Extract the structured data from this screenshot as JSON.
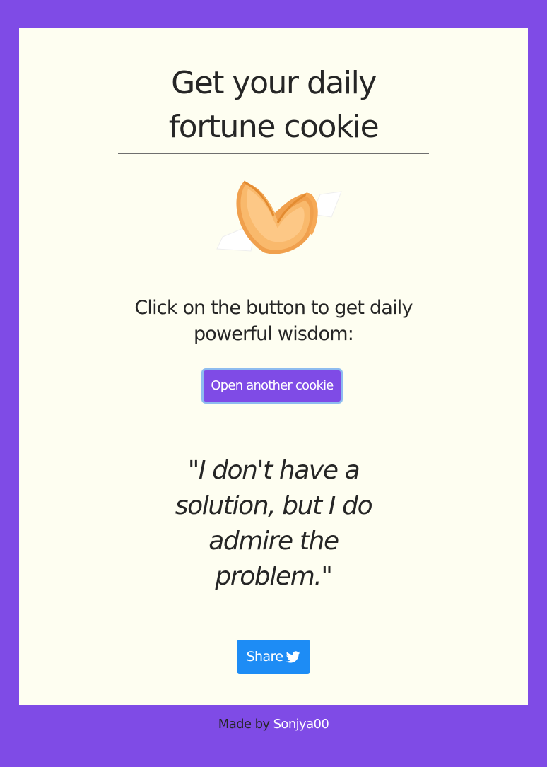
{
  "card": {
    "title": "Get your daily fortune cookie",
    "image": {
      "icon": "fortune-cookie-icon"
    },
    "intro": "Click on the button to get daily powerful wisdom:",
    "open_button_label": "Open another cookie",
    "quote": "\"I don't have a solution, but I do admire the problem.\"",
    "share": {
      "label": "Share",
      "icon": "twitter-bird-icon"
    }
  },
  "footer": {
    "prefix": "Made by ",
    "author": "Sonjya00"
  },
  "colors": {
    "page_background": "#7f4be6",
    "card_background": "#fefef1",
    "primary_button": "#7f4be6",
    "primary_button_focus_ring": "#8ebcf0",
    "share_button": "#1d8cf5",
    "text": "#262626"
  }
}
